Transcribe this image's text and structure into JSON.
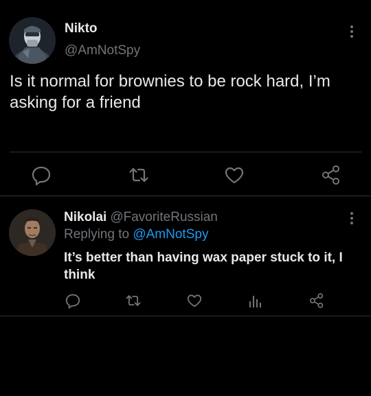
{
  "main_tweet": {
    "author_name": "Nikto",
    "author_handle": "@AmNotSpy",
    "text": "Is it normal for brownies to be rock hard, I’m asking for a friend",
    "avatar_icon": "masked-soldier-avatar",
    "actions": [
      "reply-icon",
      "retweet-icon",
      "like-icon",
      "share-icon"
    ]
  },
  "reply": {
    "author_name": "Nikolai",
    "author_handle": "@FavoriteRussian",
    "replying_prefix": "Replying to",
    "replying_to": "@AmNotSpy",
    "text": "It’s better than having wax paper stuck to it, I think",
    "avatar_icon": "man-portrait-avatar",
    "actions": [
      "reply-icon",
      "retweet-icon",
      "like-icon",
      "analytics-icon",
      "share-icon"
    ]
  },
  "colors": {
    "background": "#000000",
    "primary_text": "#e7e9ea",
    "secondary_text": "#71767b",
    "link": "#1d9bf0",
    "divider": "#2f3336"
  }
}
